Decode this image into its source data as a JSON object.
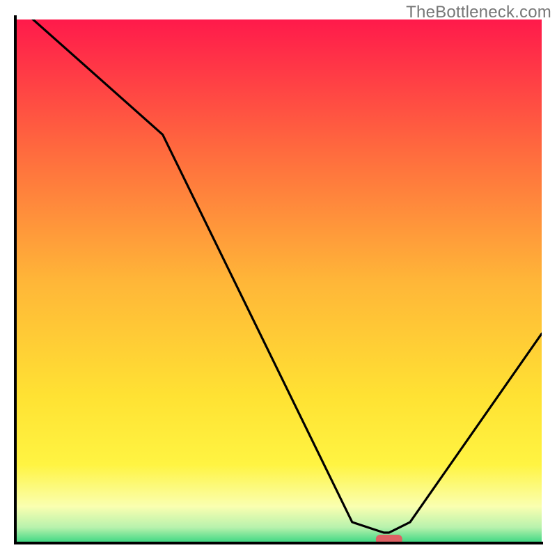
{
  "watermark": "TheBottleneck.com",
  "chart_data": {
    "type": "line",
    "title": "",
    "xlabel": "",
    "ylabel": "",
    "xlim": [
      0,
      100
    ],
    "ylim": [
      0,
      100
    ],
    "grid": false,
    "series": [
      {
        "name": "bottleneck-curve",
        "x": [
          0,
          28,
          64,
          70,
          71,
          75,
          100
        ],
        "values": [
          103,
          78,
          4,
          2,
          2,
          4,
          40
        ]
      }
    ],
    "marker": {
      "name": "sweet-spot",
      "x_center": 71,
      "width": 5,
      "color": "#de6164"
    },
    "background_gradient": {
      "stops": [
        {
          "offset": 0.0,
          "color": "#ff1a4b"
        },
        {
          "offset": 0.25,
          "color": "#ff6a3e"
        },
        {
          "offset": 0.5,
          "color": "#ffb638"
        },
        {
          "offset": 0.72,
          "color": "#ffe233"
        },
        {
          "offset": 0.85,
          "color": "#fff442"
        },
        {
          "offset": 0.93,
          "color": "#faffb0"
        },
        {
          "offset": 0.97,
          "color": "#b8f2ad"
        },
        {
          "offset": 1.0,
          "color": "#39d681"
        }
      ]
    },
    "colors": {
      "frame": "#000000",
      "curve": "#000000"
    }
  }
}
